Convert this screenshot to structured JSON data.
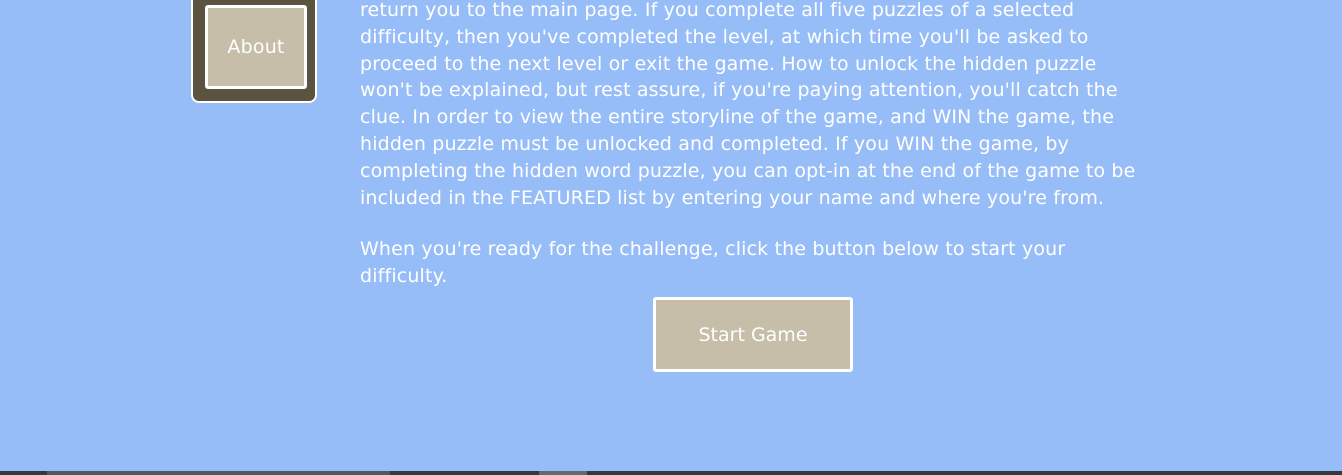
{
  "nav": {
    "about_label": "About"
  },
  "instructions": {
    "paragraph1": "return you to the main page. If you complete all five puzzles of a selected difficulty, then you've completed the level, at which time you'll be asked to proceed to the next level or exit the game. How to unlock the hidden puzzle won't be explained, but rest assure, if you're paying attention, you'll catch the clue. In order to view the entire storyline of the game, and WIN the game, the hidden puzzle must be unlocked and completed. If you WIN the game, by completing the hidden word puzzle, you can opt-in at the end of the game to be included in the FEATURED list by entering your name and where you're from.",
    "paragraph2": "When you're ready for the challenge, click the button below to start your difficulty."
  },
  "actions": {
    "start_label": "Start Game"
  },
  "colors": {
    "background": "#97bdf8",
    "panel": "#5b5240",
    "button": "#c6bea9",
    "text": "#ffffff"
  }
}
